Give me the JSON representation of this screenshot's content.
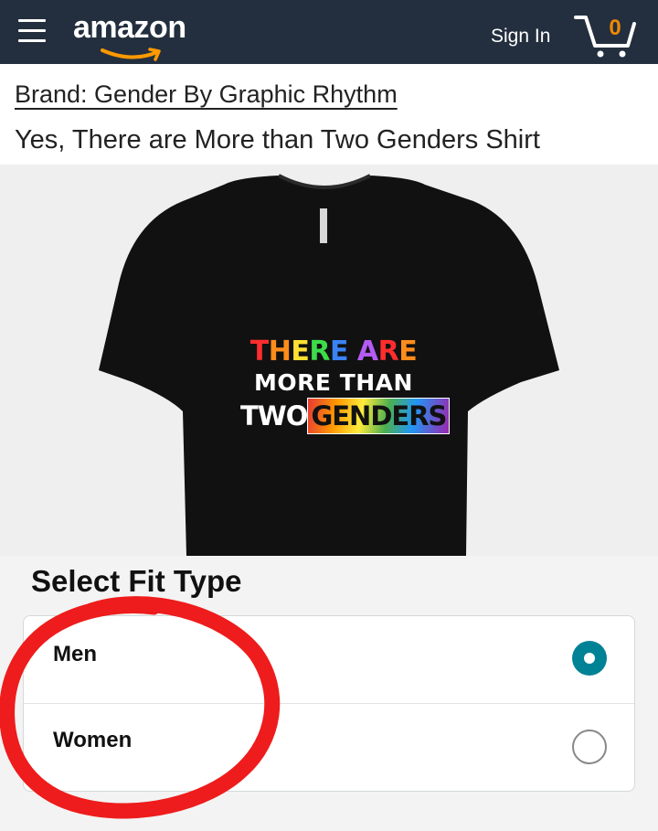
{
  "header": {
    "logo_text": "amazon",
    "signin_label": "Sign In",
    "cart_count": "0",
    "bg_color": "#232f3e",
    "cart_count_color": "#f08804",
    "icons": [
      "menu-icon",
      "cart-icon"
    ]
  },
  "product": {
    "brand": "Brand: Gender By Graphic Rhythm",
    "title": "Yes, There are More than Two Genders Shirt",
    "print": {
      "line1_words": [
        "THERE",
        "ARE"
      ],
      "line2": "MORE THAN",
      "line3_prefix": "TWO",
      "line3_highlight": "GENDERS"
    }
  },
  "fit": {
    "heading": "Select Fit Type",
    "options": [
      {
        "label": "Men",
        "selected": true
      },
      {
        "label": "Women",
        "selected": false
      }
    ],
    "selected_color": "#008296"
  },
  "annotation": {
    "color": "#ee1c1c"
  }
}
